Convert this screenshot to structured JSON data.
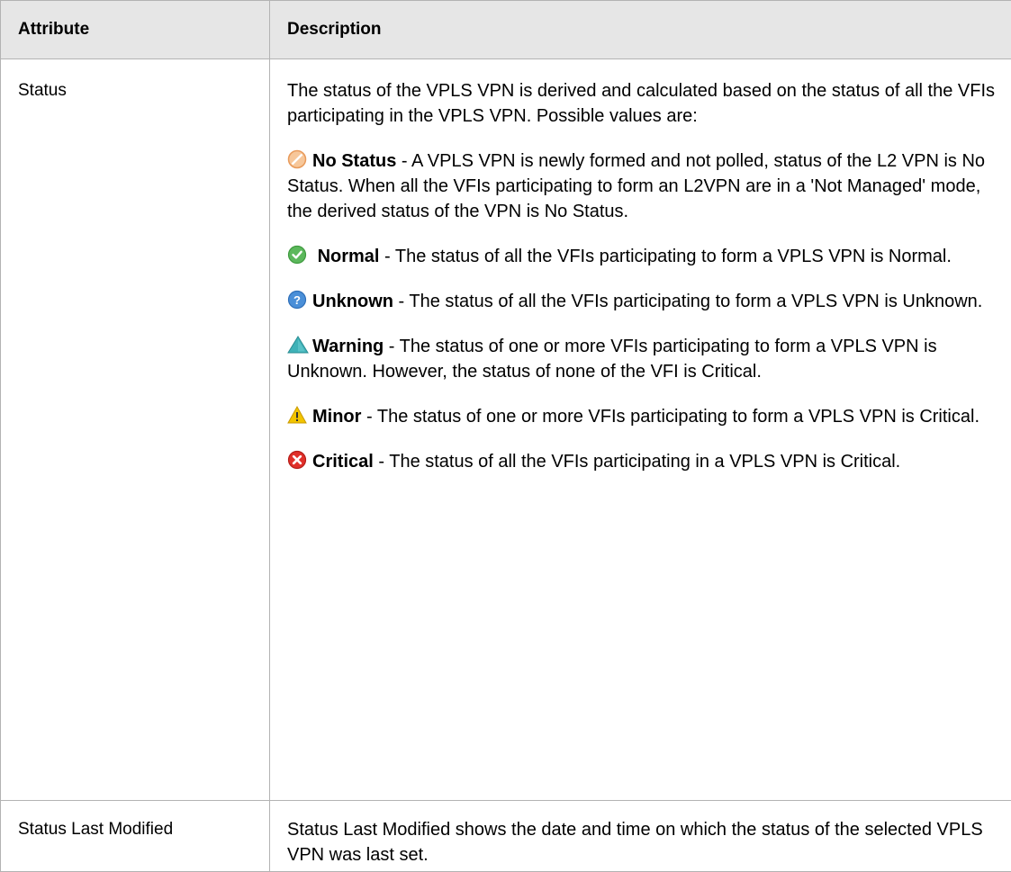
{
  "table": {
    "headers": {
      "attribute": "Attribute",
      "description": "Description"
    },
    "status_row": {
      "attribute": "Status",
      "intro": "The status of the VPLS VPN is derived and calculated based on the status of all the VFIs participating in the VPLS VPN. Possible values are:",
      "values": [
        {
          "icon": "no-status-icon",
          "icon_color": "#f0a96c",
          "name": "No Status",
          "text": " - A VPLS VPN is newly formed and not polled, status of the L2 VPN is No Status. When all the VFIs participating to form an L2VPN are in a 'Not Managed' mode, the derived status of the VPN is No Status."
        },
        {
          "icon": "normal-status-icon",
          "icon_color": "#5cb85c",
          "name": "Normal",
          "text": " - The status of all the VFIs participating to form a VPLS VPN is Normal."
        },
        {
          "icon": "unknown-status-icon",
          "icon_color": "#4a8fd8",
          "name": "Unknown",
          "text": " - The status of all the VFIs participating to form a VPLS VPN is Unknown."
        },
        {
          "icon": "warning-status-icon",
          "icon_color": "#3fb2b8",
          "name": "Warning",
          "text": " - The status of one or more VFIs participating to form a VPLS VPN is Unknown. However, the status of none of the VFI is Critical."
        },
        {
          "icon": "minor-status-icon",
          "icon_color": "#f2c400",
          "name": "Minor",
          "text": " - The status of one or more VFIs participating to form a VPLS VPN is Critical."
        },
        {
          "icon": "critical-status-icon",
          "icon_color": "#e0302a",
          "name": "Critical",
          "text": " - The status of all the VFIs participating in a VPLS VPN is Critical."
        }
      ]
    },
    "modified_row": {
      "attribute": "Status Last Modified",
      "description": "Status Last Modified shows the date and time on which the status of the selected VPLS VPN was last set."
    }
  }
}
